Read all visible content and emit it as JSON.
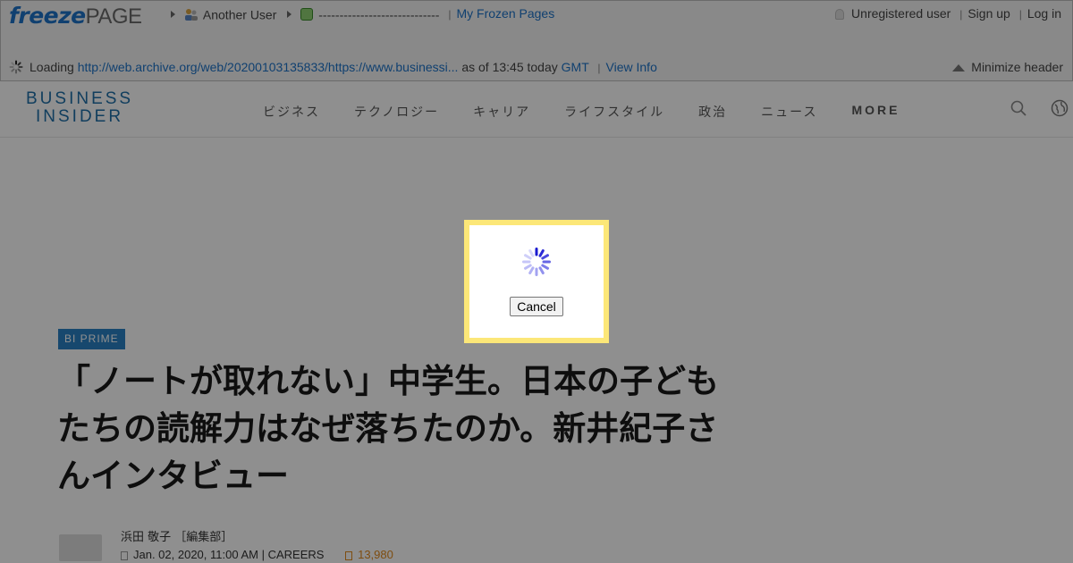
{
  "freezepage": {
    "logo_part1": "freeze",
    "logo_part2": "PAGE",
    "breadcrumb": {
      "user": "Another User",
      "dashes": "-----------------------------",
      "my_frozen_pages": "My Frozen Pages"
    },
    "account": {
      "status": "Unregistered user",
      "sign_up": "Sign up",
      "log_in": "Log in"
    },
    "loading": {
      "label": "Loading",
      "url": "http://web.archive.org/web/20200103135833/https://www.businessi...",
      "as_of": "as of 13:45 today",
      "tz": "GMT",
      "view_info": "View Info"
    },
    "minimize": "Minimize header"
  },
  "site": {
    "logo_line1": "BUSINESS",
    "logo_line2": "INSIDER",
    "nav": [
      "ビジネス",
      "テクノロジー",
      "キャリア",
      "ライフスタイル",
      "政治",
      "ニュース",
      "MORE"
    ],
    "icons": [
      "search-icon",
      "globe-icon"
    ],
    "accent": "#2980c4"
  },
  "article": {
    "badge": "BI PRIME",
    "title": "「ノートが取れない」中学生。日本の子どもたちの読解力はなぜ落ちたのか。新井紀子さんインタビュー",
    "author": "浜田 敬子 ［編集部］",
    "date": "Jan. 02, 2020, 11:00 AM",
    "category": "CAREERS",
    "views": "13,980"
  },
  "modal": {
    "cancel_label": "Cancel",
    "border_color": "#fce778"
  }
}
